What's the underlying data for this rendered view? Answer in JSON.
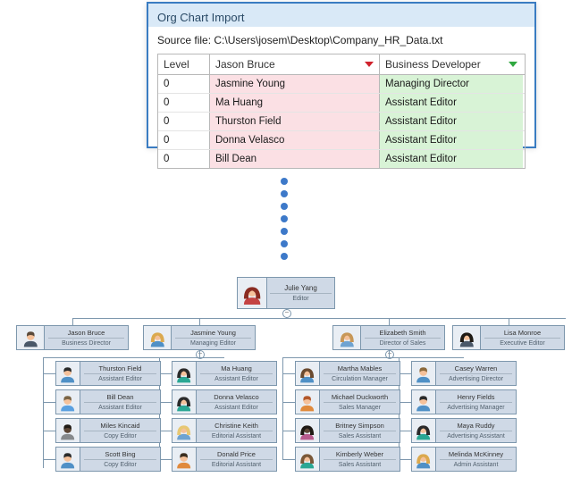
{
  "import_window": {
    "title": "Org Chart Import",
    "source_label": "Source file:",
    "source_path": "C:\\Users\\josem\\Desktop\\Company_HR_Data.txt",
    "columns": {
      "level": "Level",
      "name": "Jason Bruce",
      "role": "Business Developer"
    },
    "rows": [
      {
        "level": "0",
        "name": "Jasmine Young",
        "role": "Managing Director"
      },
      {
        "level": "0",
        "name": "Ma Huang",
        "role": "Assistant Editor"
      },
      {
        "level": "0",
        "name": "Thurston Field",
        "role": "Assistant Editor"
      },
      {
        "level": "0",
        "name": "Donna Velasco",
        "role": "Assistant Editor"
      },
      {
        "level": "0",
        "name": "Bill Dean",
        "role": "Assistant Editor"
      }
    ]
  },
  "chart_data": {
    "type": "tree",
    "root": {
      "name": "Julie Yang",
      "title": "Editor",
      "avatar": "f-red",
      "children": [
        {
          "name": "Jason Bruce",
          "title": "Business Director",
          "avatar": "m-suit"
        },
        {
          "name": "Jasmine Young",
          "title": "Managing Editor",
          "avatar": "f-blonde",
          "children": [
            {
              "name": "Thurston Field",
              "title": "Assistant Editor",
              "avatar": "m-dark"
            },
            {
              "name": "Bill Dean",
              "title": "Assistant Editor",
              "avatar": "m-blue"
            },
            {
              "name": "Miles Kincaid",
              "title": "Copy Editor",
              "avatar": "m-dark2"
            },
            {
              "name": "Scott Bing",
              "title": "Copy Editor",
              "avatar": "m-dark"
            },
            {
              "name": "Ma Huang",
              "title": "Assistant Editor",
              "avatar": "f-teal"
            },
            {
              "name": "Donna Velasco",
              "title": "Assistant Editor",
              "avatar": "f-teal2"
            },
            {
              "name": "Christine Keith",
              "title": "Editorial Assistant",
              "avatar": "f-blonde2"
            },
            {
              "name": "Donald Price",
              "title": "Editorial Assistant",
              "avatar": "m-orange"
            }
          ]
        },
        {
          "name": "Elizabeth Smith",
          "title": "Director of Sales",
          "avatar": "f-blue",
          "children": [
            {
              "name": "Martha Mables",
              "title": "Circulation Manager",
              "avatar": "f-brown"
            },
            {
              "name": "Michael Duckworth",
              "title": "Sales Manager",
              "avatar": "m-orange2"
            },
            {
              "name": "Britney Simpson",
              "title": "Sales Assistant",
              "avatar": "f-dark"
            },
            {
              "name": "Kimberly Weber",
              "title": "Sales Assistant",
              "avatar": "f-brown2"
            },
            {
              "name": "Casey Warren",
              "title": "Advertising Director",
              "avatar": "m-blue2"
            },
            {
              "name": "Henry Fields",
              "title": "Advertising Manager",
              "avatar": "m-dark"
            },
            {
              "name": "Maya Ruddy",
              "title": "Advertising Assistant",
              "avatar": "f-teal"
            },
            {
              "name": "Melinda McKinney",
              "title": "Admin Assistant",
              "avatar": "f-blonde"
            }
          ]
        },
        {
          "name": "Lisa Monroe",
          "title": "Executive Editor",
          "avatar": "f-darkhair"
        }
      ]
    }
  },
  "avatar_palette": {
    "m-suit": {
      "skin": "#f5c19a",
      "hair": "#5b4a3a",
      "body": "#4a5869"
    },
    "m-dark": {
      "skin": "#f5c19a",
      "hair": "#2b2b2b",
      "body": "#4f90c6"
    },
    "m-dark2": {
      "skin": "#5c4635",
      "hair": "#1f1a14",
      "body": "#86898c"
    },
    "m-blue": {
      "skin": "#f5c19a",
      "hair": "#7a6445",
      "body": "#5aa0e0"
    },
    "m-blue2": {
      "skin": "#f5c19a",
      "hair": "#8c6a3c",
      "body": "#4f90c6"
    },
    "m-orange": {
      "skin": "#f5c19a",
      "hair": "#3a2d1f",
      "body": "#e08a3c"
    },
    "m-orange2": {
      "skin": "#f5c19a",
      "hair": "#b2572a",
      "body": "#e08a3c"
    },
    "f-red": {
      "skin": "#f5c19a",
      "hair": "#8a2c22",
      "body": "#c44343"
    },
    "f-blonde": {
      "skin": "#f5c19a",
      "hair": "#dba94e",
      "body": "#4f90c6"
    },
    "f-blonde2": {
      "skin": "#f5c19a",
      "hair": "#e7c874",
      "body": "#6fa3d1"
    },
    "f-blue": {
      "skin": "#f5c19a",
      "hair": "#c89757",
      "body": "#6fa3d1"
    },
    "f-teal": {
      "skin": "#f5c19a",
      "hair": "#2b2b2b",
      "body": "#2aa794"
    },
    "f-teal2": {
      "skin": "#f5c19a",
      "hair": "#2b2b2b",
      "body": "#2aa794"
    },
    "f-brown": {
      "skin": "#f5c19a",
      "hair": "#6a4a2f",
      "body": "#4f90c6"
    },
    "f-brown2": {
      "skin": "#f5c19a",
      "hair": "#7a5838",
      "body": "#2aa794"
    },
    "f-dark": {
      "skin": "#5c4635",
      "hair": "#1f1a14",
      "body": "#b85b8e"
    },
    "f-darkhair": {
      "skin": "#f5c19a",
      "hair": "#1f1a14",
      "body": "#4a5869"
    }
  },
  "toggle_glyph": "–"
}
